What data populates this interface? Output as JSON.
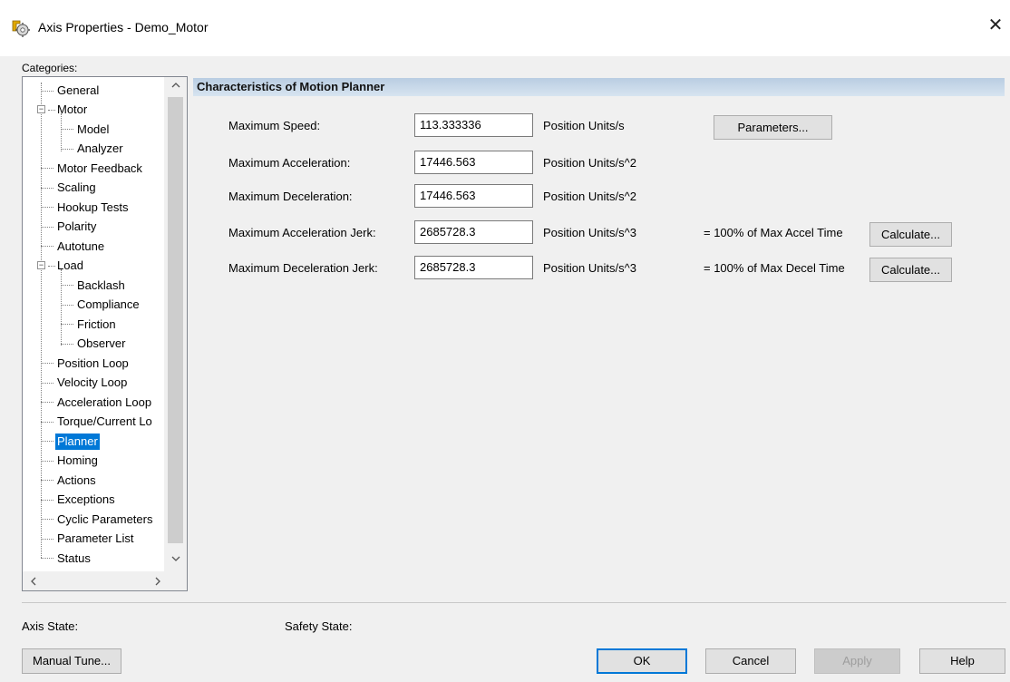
{
  "window": {
    "title": "Axis Properties - Demo_Motor",
    "close_glyph": "✕"
  },
  "categories": {
    "label": "Categories:",
    "items": [
      {
        "label": "General"
      },
      {
        "label": "Motor"
      },
      {
        "label": "Model"
      },
      {
        "label": "Analyzer"
      },
      {
        "label": "Motor Feedback"
      },
      {
        "label": "Scaling"
      },
      {
        "label": "Hookup Tests"
      },
      {
        "label": "Polarity"
      },
      {
        "label": "Autotune"
      },
      {
        "label": "Load"
      },
      {
        "label": "Backlash"
      },
      {
        "label": "Compliance"
      },
      {
        "label": "Friction"
      },
      {
        "label": "Observer"
      },
      {
        "label": "Position Loop"
      },
      {
        "label": "Velocity Loop"
      },
      {
        "label": "Acceleration Loop"
      },
      {
        "label": "Torque/Current Lo"
      },
      {
        "label": "Planner",
        "selected": true
      },
      {
        "label": "Homing"
      },
      {
        "label": "Actions"
      },
      {
        "label": "Exceptions"
      },
      {
        "label": "Cyclic Parameters"
      },
      {
        "label": "Parameter List"
      },
      {
        "label": "Status"
      }
    ],
    "expand_glyph": "−"
  },
  "panel": {
    "title": "Characteristics of Motion Planner",
    "rows": [
      {
        "label": "Maximum Speed:",
        "value": "113.333336",
        "unit": "Position Units/s"
      },
      {
        "label": "Maximum Acceleration:",
        "value": "17446.563",
        "unit": "Position Units/s^2"
      },
      {
        "label": "Maximum Deceleration:",
        "value": "17446.563",
        "unit": "Position Units/s^2"
      },
      {
        "label": "Maximum Acceleration Jerk:",
        "value": "2685728.3",
        "unit": "Position Units/s^3",
        "note": "= 100% of Max Accel Time",
        "button": "Calculate..."
      },
      {
        "label": "Maximum Deceleration Jerk:",
        "value": "2685728.3",
        "unit": "Position Units/s^3",
        "note": "= 100% of Max Decel Time",
        "button": "Calculate..."
      }
    ],
    "parameters_button": "Parameters..."
  },
  "status": {
    "axis_state_label": "Axis State:",
    "safety_state_label": "Safety State:"
  },
  "footer": {
    "manual_tune": "Manual Tune...",
    "ok": "OK",
    "cancel": "Cancel",
    "apply": "Apply",
    "help": "Help"
  },
  "icons": {
    "app": "axis-properties-icon",
    "close": "close-icon",
    "scroll_up": "chevron-up-icon",
    "scroll_down": "chevron-down-icon",
    "scroll_left": "chevron-left-icon",
    "scroll_right": "chevron-right-icon"
  },
  "colors": {
    "selection": "#0078d7",
    "header_band": "#c6d7ea"
  }
}
